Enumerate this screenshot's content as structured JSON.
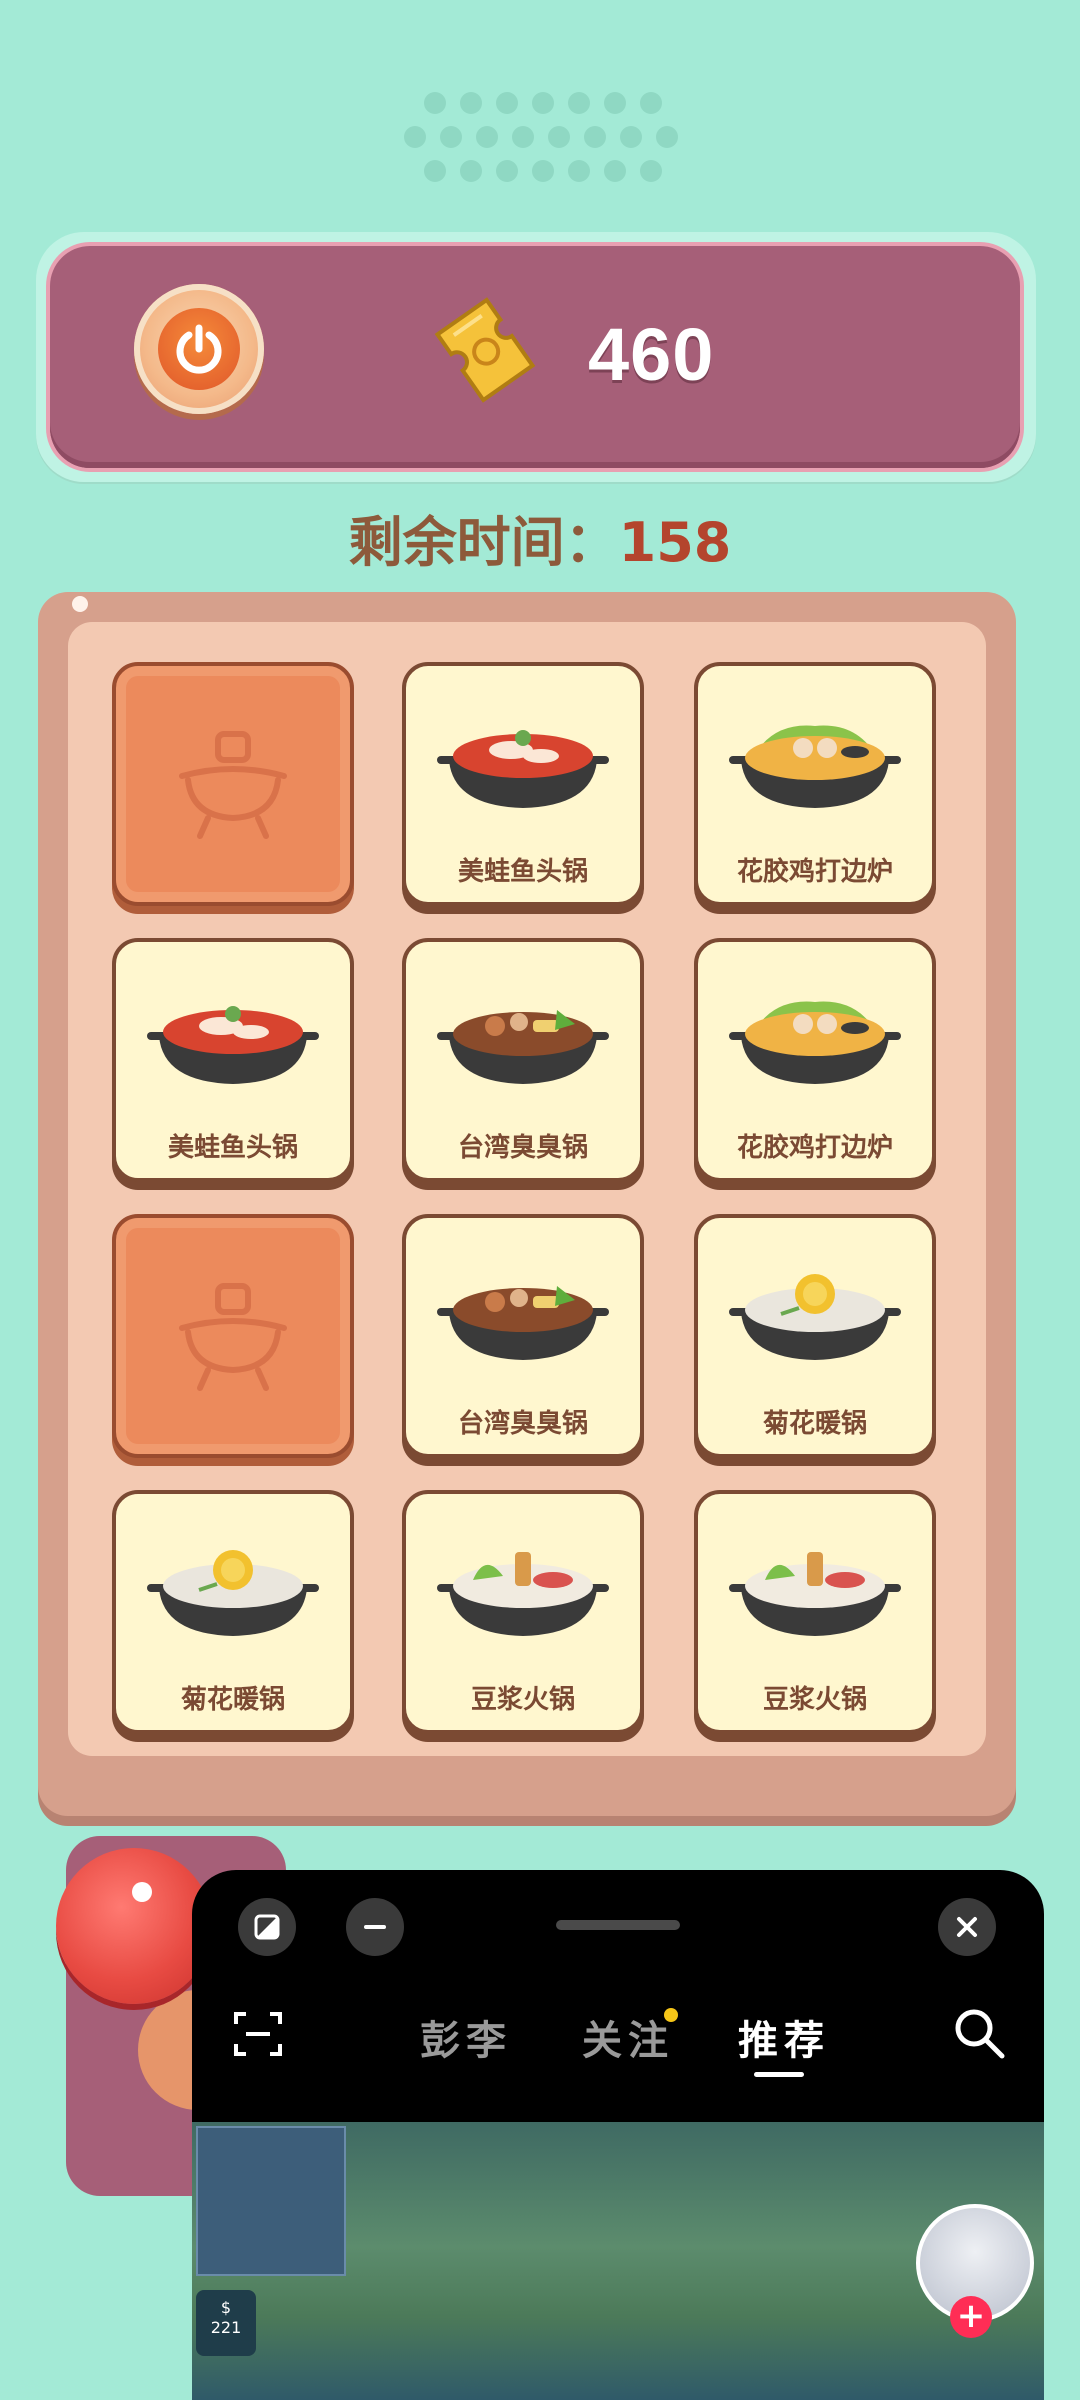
{
  "header": {
    "score": "460",
    "timer_label": "剩余时间",
    "timer_separator": "：",
    "timer_value": "158"
  },
  "board": {
    "tiles": [
      {
        "state": "back",
        "label": ""
      },
      {
        "state": "face",
        "label": "美蛙鱼头锅",
        "dish": "fish-pot-icon"
      },
      {
        "state": "face",
        "label": "花胶鸡打边炉",
        "dish": "chicken-pot-icon"
      },
      {
        "state": "face",
        "label": "美蛙鱼头锅",
        "dish": "fish-pot-icon"
      },
      {
        "state": "face",
        "label": "台湾臭臭锅",
        "dish": "stinky-pot-icon"
      },
      {
        "state": "face",
        "label": "花胶鸡打边炉",
        "dish": "chicken-pot-icon"
      },
      {
        "state": "back",
        "label": ""
      },
      {
        "state": "face",
        "label": "台湾臭臭锅",
        "dish": "stinky-pot-icon"
      },
      {
        "state": "face",
        "label": "菊花暖锅",
        "dish": "chrysanthemum-pot-icon"
      },
      {
        "state": "face",
        "label": "菊花暖锅",
        "dish": "chrysanthemum-pot-icon"
      },
      {
        "state": "face",
        "label": "豆浆火锅",
        "dish": "soymilk-pot-icon"
      },
      {
        "state": "face",
        "label": "豆浆火锅",
        "dish": "soymilk-pot-icon"
      }
    ]
  },
  "floating_window": {
    "tabs": [
      {
        "label": "彭李",
        "active": false
      },
      {
        "label": "关注",
        "active": false,
        "has_dot": true
      },
      {
        "label": "推荐",
        "active": true
      }
    ],
    "coin_label": "221"
  },
  "colors": {
    "background": "#a3ead6",
    "top_bar": "#a65f78",
    "tile_face": "#fff7cf",
    "tile_back": "#ec8a5c",
    "timer_value": "#b4452d"
  }
}
